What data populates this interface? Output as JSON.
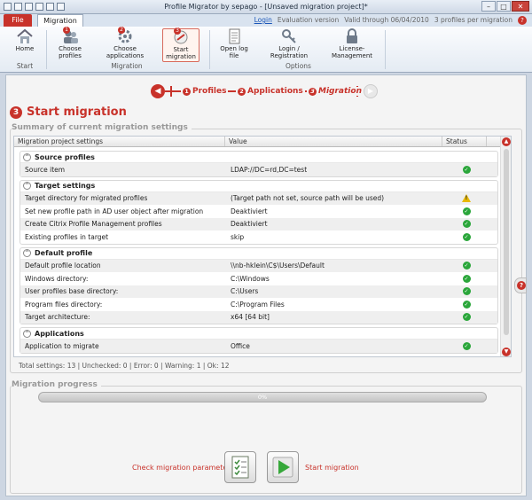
{
  "window": {
    "title": "Profile Migrator by sepago - [Unsaved migration project]*",
    "help": "?"
  },
  "tabs": {
    "file": "File",
    "migration": "Migration",
    "login": "Login",
    "evaluation": "Evaluation version",
    "valid": "Valid through 06/04/2010",
    "profiles_per": "3 profiles per migration"
  },
  "ribbon": {
    "home": "Home",
    "choose_profiles": "Choose profiles",
    "choose_applications": "Choose applications",
    "start_migration": "Start migration",
    "open_log": "Open log file",
    "login_registration": "Login / Registration",
    "license": "License-Management",
    "group_start": "Start",
    "group_migration": "Migration",
    "group_options": "Options",
    "badge1": "1",
    "badge2": "2",
    "badge3": "3"
  },
  "wizard": {
    "step1_num": "1",
    "step1": "Profiles",
    "step2_num": "2",
    "step2": "Applications",
    "step3_num": "3",
    "step3": "Migration"
  },
  "heading": {
    "num": "3",
    "title": "Start migration"
  },
  "summary_group": "Summary of current migration settings",
  "table": {
    "col_setting": "Migration project settings",
    "col_value": "Value",
    "col_status": "Status",
    "sections": [
      {
        "title": "Source profiles",
        "rows": [
          {
            "setting": "Source item",
            "value": "LDAP://DC=rd,DC=test",
            "status": "ok"
          }
        ]
      },
      {
        "title": "Target settings",
        "rows": [
          {
            "setting": "Target directory for migrated profiles",
            "value": "(Target path not set, source path will be used)",
            "status": "warning"
          },
          {
            "setting": "Set new profile path in AD user object after migration",
            "value": "Deaktiviert",
            "status": "ok"
          },
          {
            "setting": "Create Citrix Profile Management profiles",
            "value": "Deaktiviert",
            "status": "ok"
          },
          {
            "setting": "Existing profiles in target",
            "value": "skip",
            "status": "ok"
          }
        ]
      },
      {
        "title": "Default profile",
        "rows": [
          {
            "setting": "Default profile location",
            "value": "\\\\nb-hklein\\C$\\Users\\Default",
            "status": "ok"
          },
          {
            "setting": "Windows directory:",
            "value": "C:\\Windows",
            "status": "ok"
          },
          {
            "setting": "User profiles base directory:",
            "value": "C:\\Users",
            "status": "ok"
          },
          {
            "setting": "Program files directory:",
            "value": "C:\\Program Files",
            "status": "ok"
          },
          {
            "setting": "Target architecture:",
            "value": "x64 [64 bit]",
            "status": "ok"
          }
        ]
      },
      {
        "title": "Applications",
        "rows": [
          {
            "setting": "Application to migrate",
            "value": "Office",
            "status": "ok"
          }
        ]
      }
    ]
  },
  "summary_line": "Total settings: 13 | Unchecked: 0 | Error: 0 | Warning: 1 | Ok: 12",
  "progress_group": "Migration progress",
  "progress": {
    "percent": 0,
    "label": "0%"
  },
  "actions": {
    "check": "Check migration parameters",
    "start": "Start migration"
  },
  "colors": {
    "accent": "#c8322a",
    "ok": "#2aa63a",
    "warning": "#e8b800"
  }
}
